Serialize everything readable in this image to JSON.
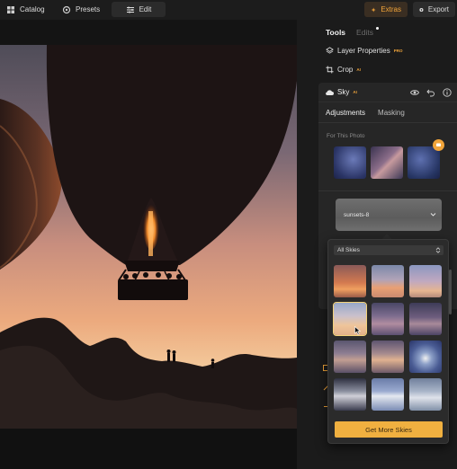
{
  "topbar": {
    "catalog": "Catalog",
    "presets": "Presets",
    "edit": "Edit",
    "extras": "Extras",
    "export": "Export"
  },
  "panel": {
    "tab_tools": "Tools",
    "tab_edits": "Edits",
    "layer_properties": "Layer Properties",
    "layer_properties_badge": "PRO",
    "crop": "Crop",
    "crop_badge": "AI"
  },
  "sky_tool": {
    "title": "Sky",
    "title_badge": "AI",
    "tab_adjustments": "Adjustments",
    "tab_masking": "Masking",
    "section_label": "For This Photo",
    "selected_sky": "sunsets-8",
    "filter_value": "All Skies",
    "more_button": "Get More Skies"
  },
  "colors": {
    "accent": "#f0b040",
    "extras_text": "#f4a63a",
    "panel_bg": "#1b1b1b",
    "card_bg": "#262626"
  },
  "icons": [
    "catalog-icon",
    "presets-icon",
    "edit-icon",
    "extras-icon",
    "export-icon",
    "layers-icon",
    "crop-icon",
    "cloud-icon",
    "eye-icon",
    "undo-icon",
    "info-icon",
    "chevron-down-icon",
    "updown-icon"
  ]
}
